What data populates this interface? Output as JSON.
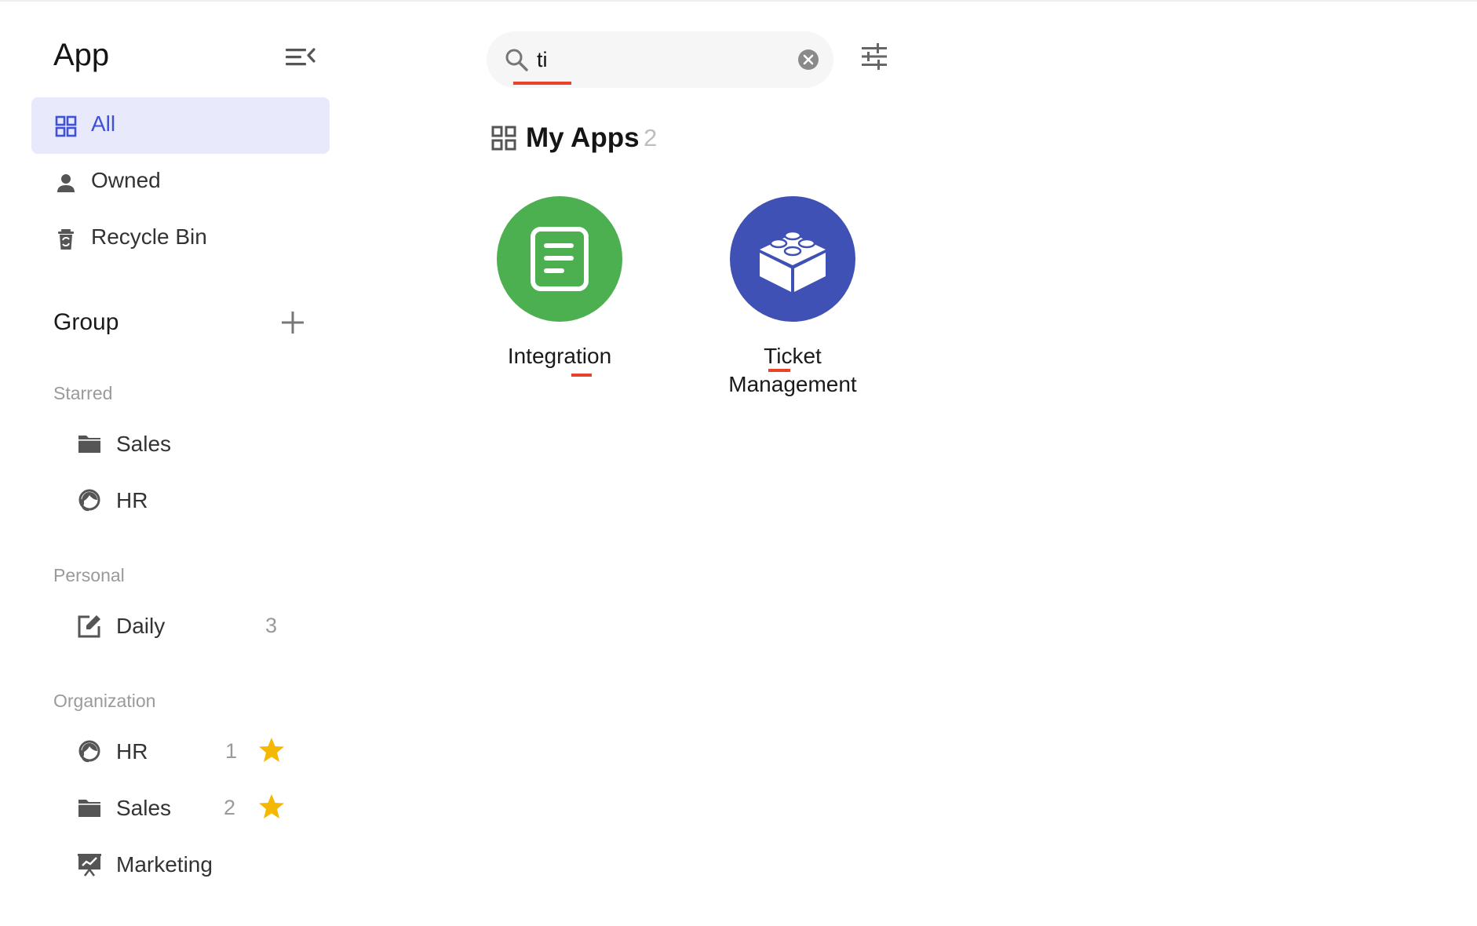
{
  "sidebar": {
    "title": "App",
    "nav": [
      {
        "label": "All",
        "icon": "grid-icon",
        "active": true
      },
      {
        "label": "Owned",
        "icon": "person-icon",
        "active": false
      },
      {
        "label": "Recycle Bin",
        "icon": "recycle-bin-icon",
        "active": false
      }
    ],
    "group_title": "Group",
    "sections": [
      {
        "label": "Starred",
        "items": [
          {
            "label": "Sales",
            "icon": "folder-icon"
          },
          {
            "label": "HR",
            "icon": "headset-icon"
          }
        ]
      },
      {
        "label": "Personal",
        "items": [
          {
            "label": "Daily",
            "icon": "edit-square-icon",
            "count": "3"
          }
        ]
      },
      {
        "label": "Organization",
        "items": [
          {
            "label": "HR",
            "icon": "headset-icon",
            "count": "1",
            "starred": true
          },
          {
            "label": "Sales",
            "icon": "folder-icon",
            "count": "2",
            "starred": true
          },
          {
            "label": "Marketing",
            "icon": "presentation-chart-icon"
          }
        ]
      }
    ]
  },
  "search": {
    "value": "ti",
    "placeholder": ""
  },
  "main": {
    "section_title": "My Apps",
    "section_count": "2",
    "apps": [
      {
        "name": "Integration",
        "icon": "document-lines-icon",
        "color": "#4caf50"
      },
      {
        "name_line1": "Ticket",
        "name_line2": "Management",
        "icon": "building-block-icon",
        "color": "#3f51b5"
      }
    ]
  },
  "colors": {
    "accent": "#3f51d6",
    "active_bg": "#e8eafb",
    "highlight": "#e8432a",
    "star": "#f5b800",
    "muted": "#9a9a9a"
  }
}
